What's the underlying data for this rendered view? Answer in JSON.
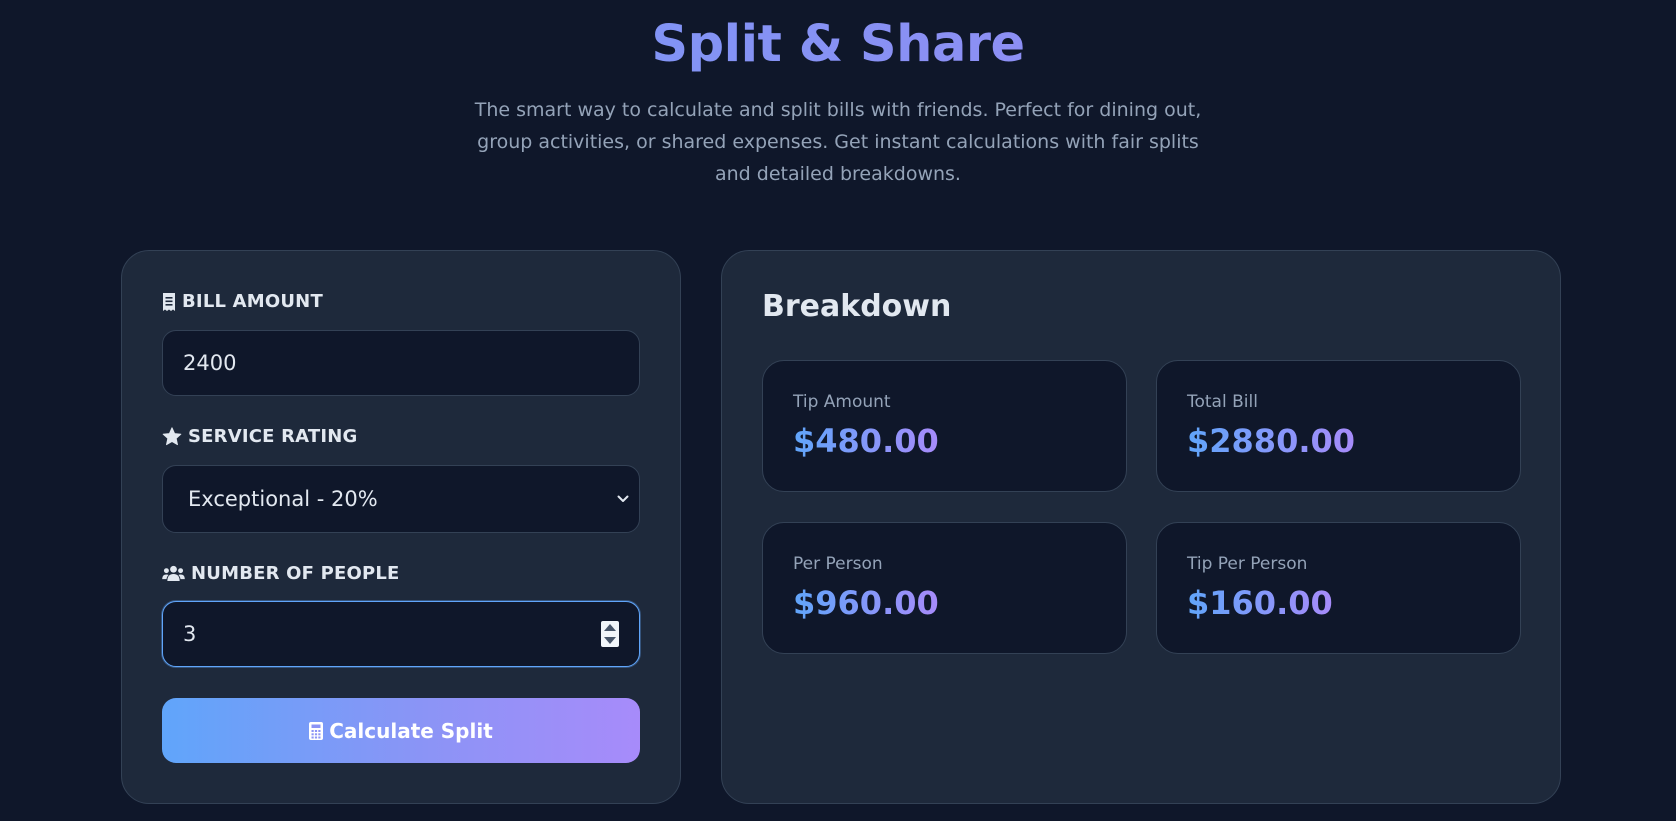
{
  "header": {
    "title": "Split & Share",
    "subtitle": "The smart way to calculate and split bills with friends. Perfect for dining out, group activities, or shared expenses. Get instant calculations with fair splits and detailed breakdowns."
  },
  "form": {
    "bill_label": "BILL AMOUNT",
    "bill_value": "2400",
    "rating_label": "SERVICE RATING",
    "rating_selected": "Exceptional - 20%",
    "people_label": "NUMBER OF PEOPLE",
    "people_value": "3",
    "calculate_label": "Calculate Split"
  },
  "breakdown": {
    "title": "Breakdown",
    "tip_amount": {
      "label": "Tip Amount",
      "value": "$480.00"
    },
    "total_bill": {
      "label": "Total Bill",
      "value": "$2880.00"
    },
    "per_person": {
      "label": "Per Person",
      "value": "$960.00"
    },
    "tip_per_person": {
      "label": "Tip Per Person",
      "value": "$160.00"
    }
  },
  "icons": {
    "bill": "receipt-icon",
    "rating": "star-icon",
    "people": "users-icon",
    "calculate": "calculator-icon",
    "dropdown": "chevron-down-icon"
  },
  "colors": {
    "background": "#0f172a",
    "card": "#1e293b",
    "accent_start": "#60a5fa",
    "accent_end": "#a78bfa"
  }
}
